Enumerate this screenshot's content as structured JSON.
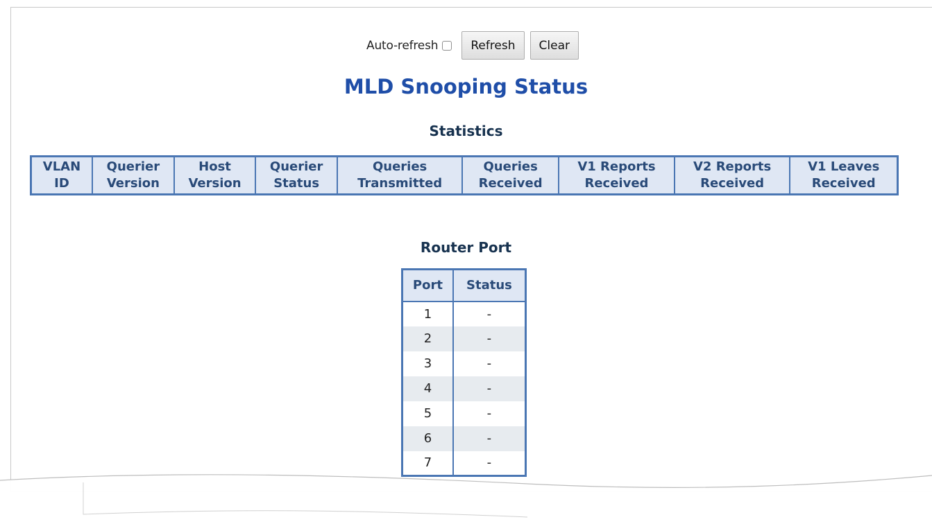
{
  "toolbar": {
    "auto_refresh_label": "Auto-refresh",
    "refresh_label": "Refresh",
    "clear_label": "Clear"
  },
  "page_title": "MLD Snooping Status",
  "statistics": {
    "heading": "Statistics",
    "columns": [
      [
        "VLAN",
        "ID"
      ],
      [
        "Querier",
        "Version"
      ],
      [
        "Host",
        "Version"
      ],
      [
        "Querier",
        "Status"
      ],
      [
        "Queries",
        "Transmitted"
      ],
      [
        "Queries",
        "Received"
      ],
      [
        "V1 Reports",
        "Received"
      ],
      [
        "V2 Reports",
        "Received"
      ],
      [
        "V1 Leaves",
        "Received"
      ]
    ]
  },
  "router_port": {
    "heading": "Router Port",
    "columns": [
      "Port",
      "Status"
    ],
    "rows": [
      [
        "1",
        "-"
      ],
      [
        "2",
        "-"
      ],
      [
        "3",
        "-"
      ],
      [
        "4",
        "-"
      ],
      [
        "5",
        "-"
      ],
      [
        "6",
        "-"
      ],
      [
        "7",
        "-"
      ]
    ]
  }
}
